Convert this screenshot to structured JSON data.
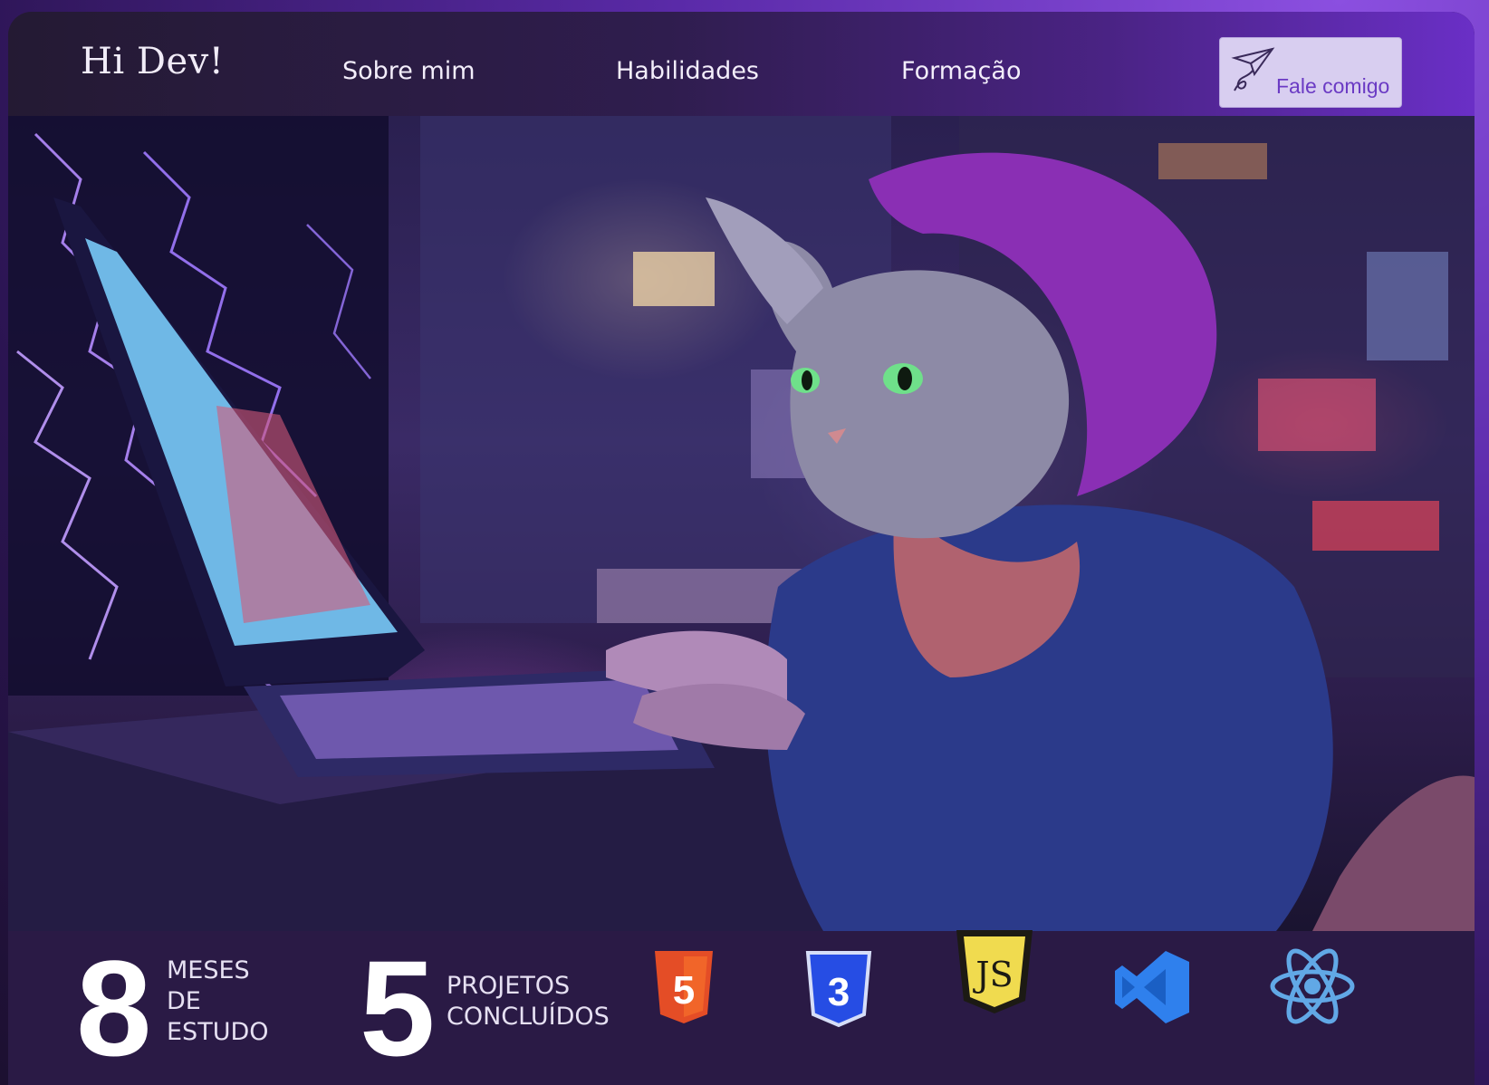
{
  "header": {
    "logo": "Hi Dev!",
    "nav": [
      {
        "label": "Sobre mim"
      },
      {
        "label": "Habilidades"
      },
      {
        "label": "Formação"
      }
    ],
    "contact_button": {
      "label": "Fale comigo",
      "icon": "paper-plane-icon"
    }
  },
  "hero": {
    "image": "cat-in-purple-hoodie-typing-on-laptop-illustration"
  },
  "stats": [
    {
      "number": "8",
      "lines": [
        "MESES",
        "DE",
        "ESTUDO"
      ]
    },
    {
      "number": "5",
      "lines": [
        "PROJETOS",
        "CONCLUÍDOS"
      ]
    }
  ],
  "technologies": [
    {
      "icon": "html5-icon",
      "text": "5",
      "color": "#e44d26"
    },
    {
      "icon": "css3-icon",
      "text": "3",
      "color": "#264de4"
    },
    {
      "icon": "javascript-icon",
      "text": "JS",
      "color": "#f0db4f"
    },
    {
      "icon": "vscode-icon",
      "color": "#2f80ed"
    },
    {
      "icon": "react-icon",
      "color": "#61a8e6"
    }
  ],
  "colors": {
    "accent": "#6b3bc4",
    "header_bg": "#2f1d4e",
    "stats_bg": "#2a1a45"
  }
}
